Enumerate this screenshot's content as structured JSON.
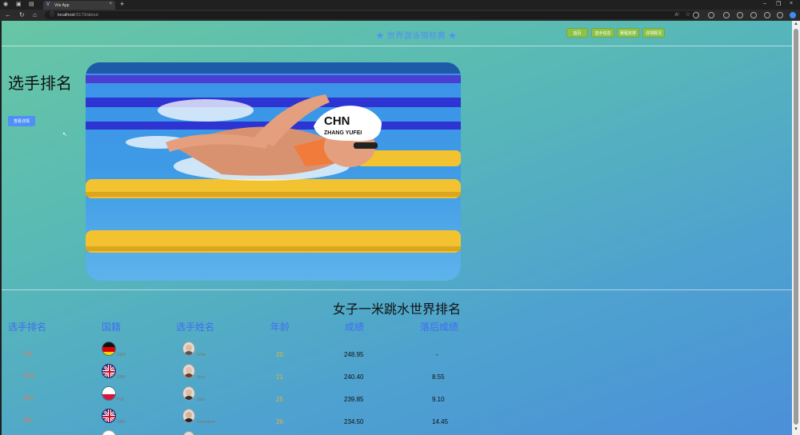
{
  "browser": {
    "tab_title": "Vite App",
    "url_host": "localhost",
    "url_path": ":5173/about"
  },
  "site": {
    "title": "★ 世界游泳锦标赛 ★",
    "nav": [
      "首页",
      "选手信息",
      "赛程安排",
      "详情概况"
    ]
  },
  "hero": {
    "heading": "选手排名",
    "detail_button": "查看详情",
    "cap_text": "CHN",
    "cap_name": "ZHANG YUFEI"
  },
  "table": {
    "title": "女子一米跳水世界排名",
    "headers": [
      "选手排名",
      "国籍",
      "选手姓名",
      "年龄",
      "成绩",
      "落后成绩"
    ],
    "rows": [
      {
        "rank": "1st",
        "country": "GER",
        "name": "Frida",
        "age": "20",
        "score": "248.95",
        "behind": "-",
        "flag": "ger"
      },
      {
        "rank": "2nd",
        "country": "GBR",
        "name": "Amy",
        "age": "21",
        "score": "240.40",
        "behind": "8.55",
        "flag": "gbr"
      },
      {
        "rank": "3rd",
        "country": "POL",
        "name": "Julia",
        "age": "25",
        "score": "239.85",
        "behind": "9.10",
        "flag": "pol"
      },
      {
        "rank": "4th",
        "country": "GBR",
        "name": "Grashame",
        "age": "26",
        "score": "234.50",
        "behind": "14.45",
        "flag": "gbr"
      }
    ]
  },
  "colors": {
    "accent_blue": "#4f8ff7",
    "nav_green": "#8bc34a",
    "rank_orange": "#e07a5f",
    "age_yellow": "#e6b23c"
  }
}
